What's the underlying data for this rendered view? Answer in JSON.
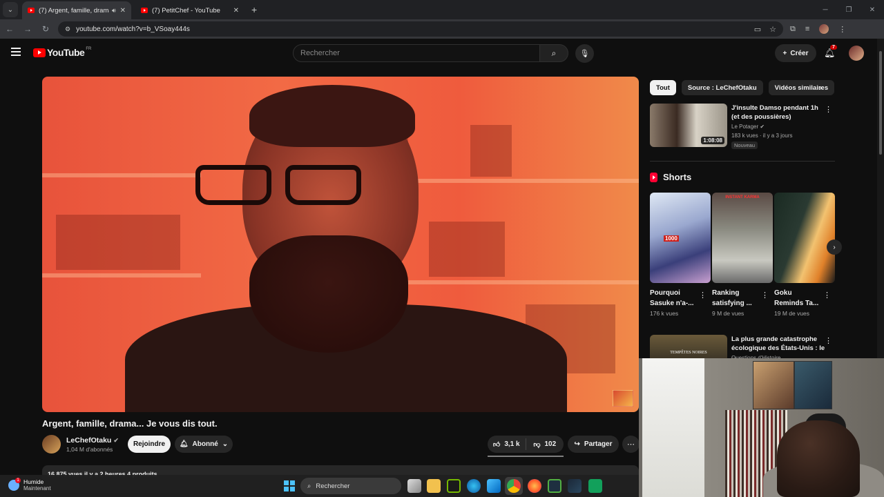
{
  "browser": {
    "tabs": [
      {
        "title": "(7) Argent, famille, drama...",
        "active": true
      },
      {
        "title": "(7) PetitChef - YouTube",
        "active": false
      }
    ],
    "url": "youtube.com/watch?v=b_VSoay444s"
  },
  "header": {
    "logo_text": "YouTube",
    "country": "FR",
    "search_placeholder": "Rechercher",
    "create_label": "Créer",
    "notifications": "7"
  },
  "video": {
    "title": "Argent, famille, drama... Je vous dis tout.",
    "channel": "LeChefOtaku",
    "subscribers": "1,04 M d'abonnés",
    "join_label": "Rejoindre",
    "subscribed_label": "Abonné",
    "likes": "3,1 k",
    "dislikes": "102",
    "share_label": "Partager",
    "description_preview": "16 875 vues  il y a 2 heures  4 produits"
  },
  "sidebar": {
    "chips": [
      "Tout",
      "Source : LeChefOtaku",
      "Vidéos similaires"
    ],
    "recommendations": [
      {
        "title": "J'insulte Damso pendant 1h (et des poussières)",
        "channel": "Le Potager",
        "meta": "183 k vues · il y a 3 jours",
        "duration": "1:08:08",
        "badge": "Nouveau"
      },
      {
        "title": "La plus grande catastrophe écologique des États-Unis : le ...",
        "channel": "Questions d'Histoire",
        "thumb_text": "TEMPÊTES NOIRES"
      }
    ],
    "shorts_title": "Shorts",
    "shorts": [
      {
        "title": "Pourquoi Sasuke n'a-...",
        "views": "176 k vues",
        "overlay": "1000"
      },
      {
        "title": "Ranking satisfying ...",
        "views": "9 M de vues",
        "overlay": "INSTANT KARMA"
      },
      {
        "title": "Goku Reminds Ta...",
        "views": "19 M de vues"
      }
    ]
  },
  "taskbar": {
    "weather_title": "Humide",
    "weather_sub": "Maintenant",
    "weather_badge": "1",
    "search_label": "Rechercher"
  },
  "colors": {
    "accent": "#ff0000",
    "background": "#0f0f0f",
    "chip_bg": "#272727"
  }
}
